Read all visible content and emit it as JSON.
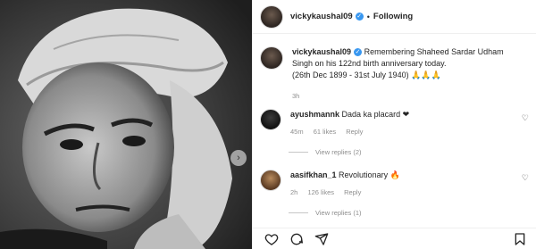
{
  "post": {
    "username": "vickykaushal09",
    "follow_status": "Following",
    "caption": "Remembering Shaheed Sardar Udham Singh on his 122nd birth anniversary today.",
    "caption_dates": "(26th Dec 1899 - 31st July 1940) 🙏🙏🙏",
    "time": "3h"
  },
  "comments": [
    {
      "username": "ayushmannk",
      "text": "Dada ka placard ❤",
      "time": "45m",
      "likes": "61 likes",
      "reply": "Reply",
      "view_replies": "View replies (2)"
    },
    {
      "username": "aasifkhan_1",
      "text": "Revolutionary 🔥",
      "time": "2h",
      "likes": "126 likes",
      "reply": "Reply",
      "view_replies": "View replies (1)"
    }
  ],
  "icons": {
    "like": "heart-icon",
    "comment": "comment-icon",
    "share": "share-icon",
    "save": "bookmark-icon"
  }
}
